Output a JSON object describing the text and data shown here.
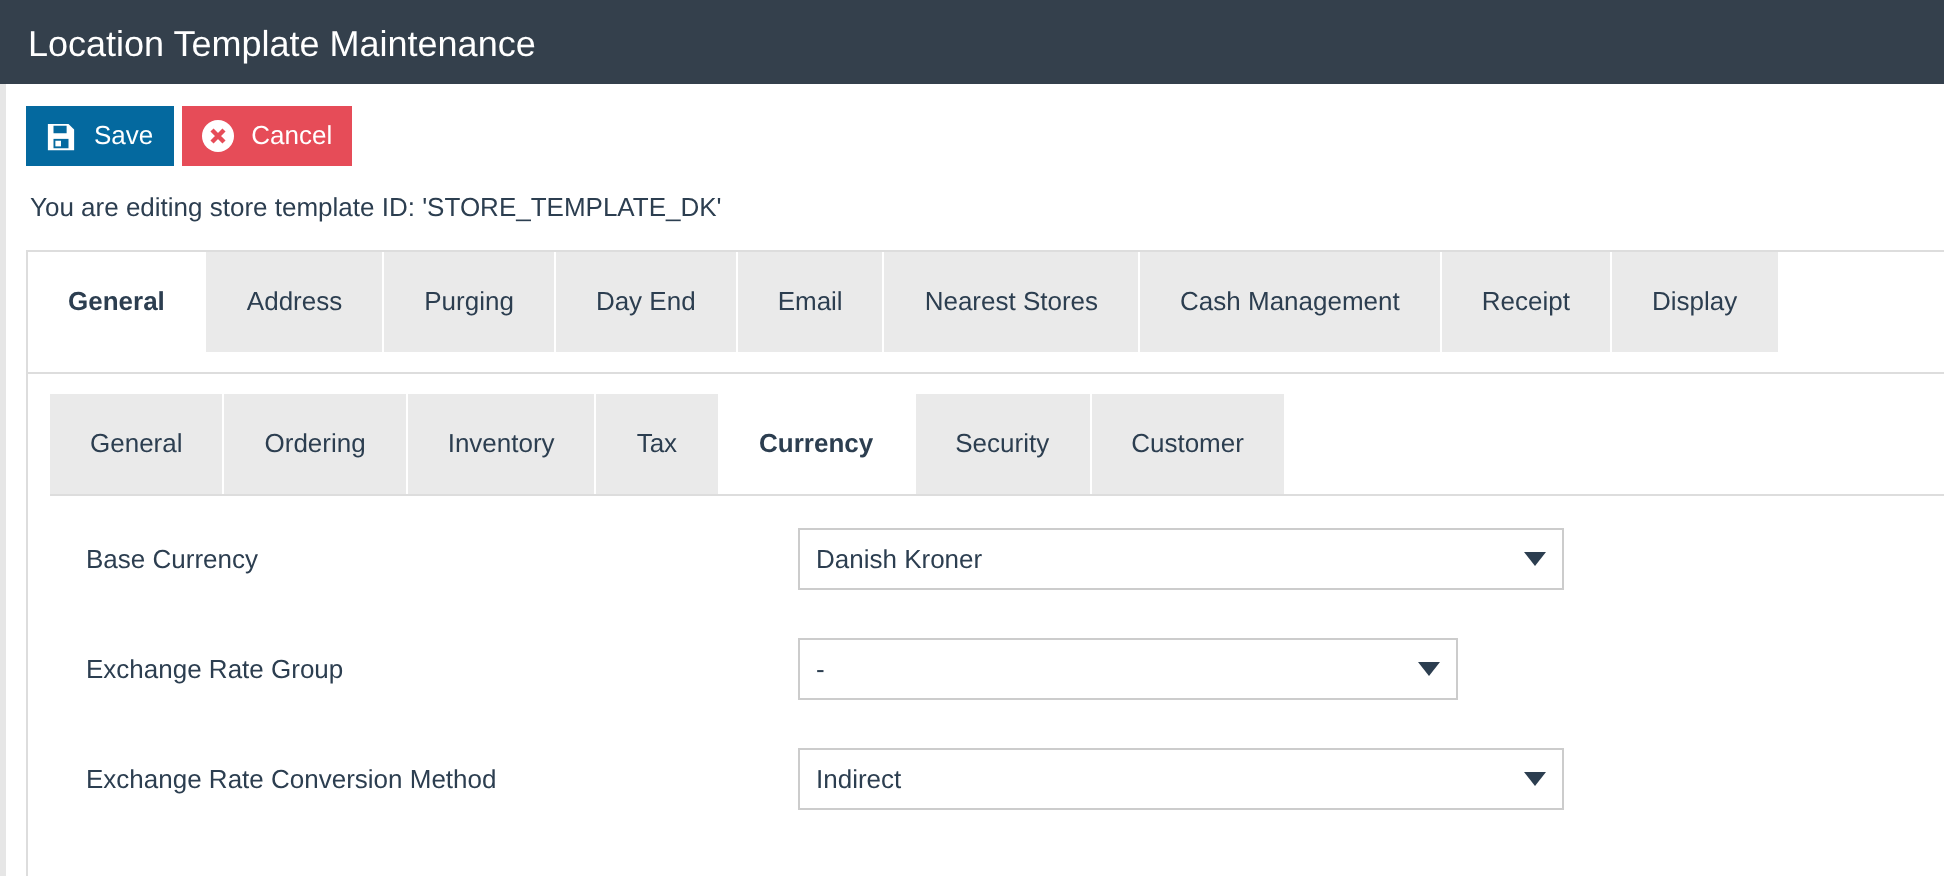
{
  "window": {
    "title": "Location Template Maintenance"
  },
  "buttons": [
    {
      "kind": "save",
      "label": "Save"
    },
    {
      "kind": "cancel",
      "label": "Cancel"
    }
  ],
  "editing_message": "You are editing store template ID: 'STORE_TEMPLATE_DK'",
  "tabs": [
    {
      "label": "General",
      "selected": true
    },
    {
      "label": "Address",
      "selected": false
    },
    {
      "label": "Purging",
      "selected": false
    },
    {
      "label": "Day End",
      "selected": false
    },
    {
      "label": "Email",
      "selected": false
    },
    {
      "label": "Nearest Stores",
      "selected": false
    },
    {
      "label": "Cash Management",
      "selected": false
    },
    {
      "label": "Receipt",
      "selected": false
    },
    {
      "label": "Display",
      "selected": false
    }
  ],
  "subtabs": [
    {
      "label": "General",
      "selected": false
    },
    {
      "label": "Ordering",
      "selected": false
    },
    {
      "label": "Inventory",
      "selected": false
    },
    {
      "label": "Tax",
      "selected": false
    },
    {
      "label": "Currency",
      "selected": true
    },
    {
      "label": "Security",
      "selected": false
    },
    {
      "label": "Customer",
      "selected": false
    }
  ],
  "fields": [
    {
      "label": "Base Currency",
      "value": "Danish Kroner"
    },
    {
      "label": "Exchange Rate Group",
      "value": "-"
    },
    {
      "label": "Exchange Rate Conversion Method",
      "value": "Indirect"
    }
  ]
}
